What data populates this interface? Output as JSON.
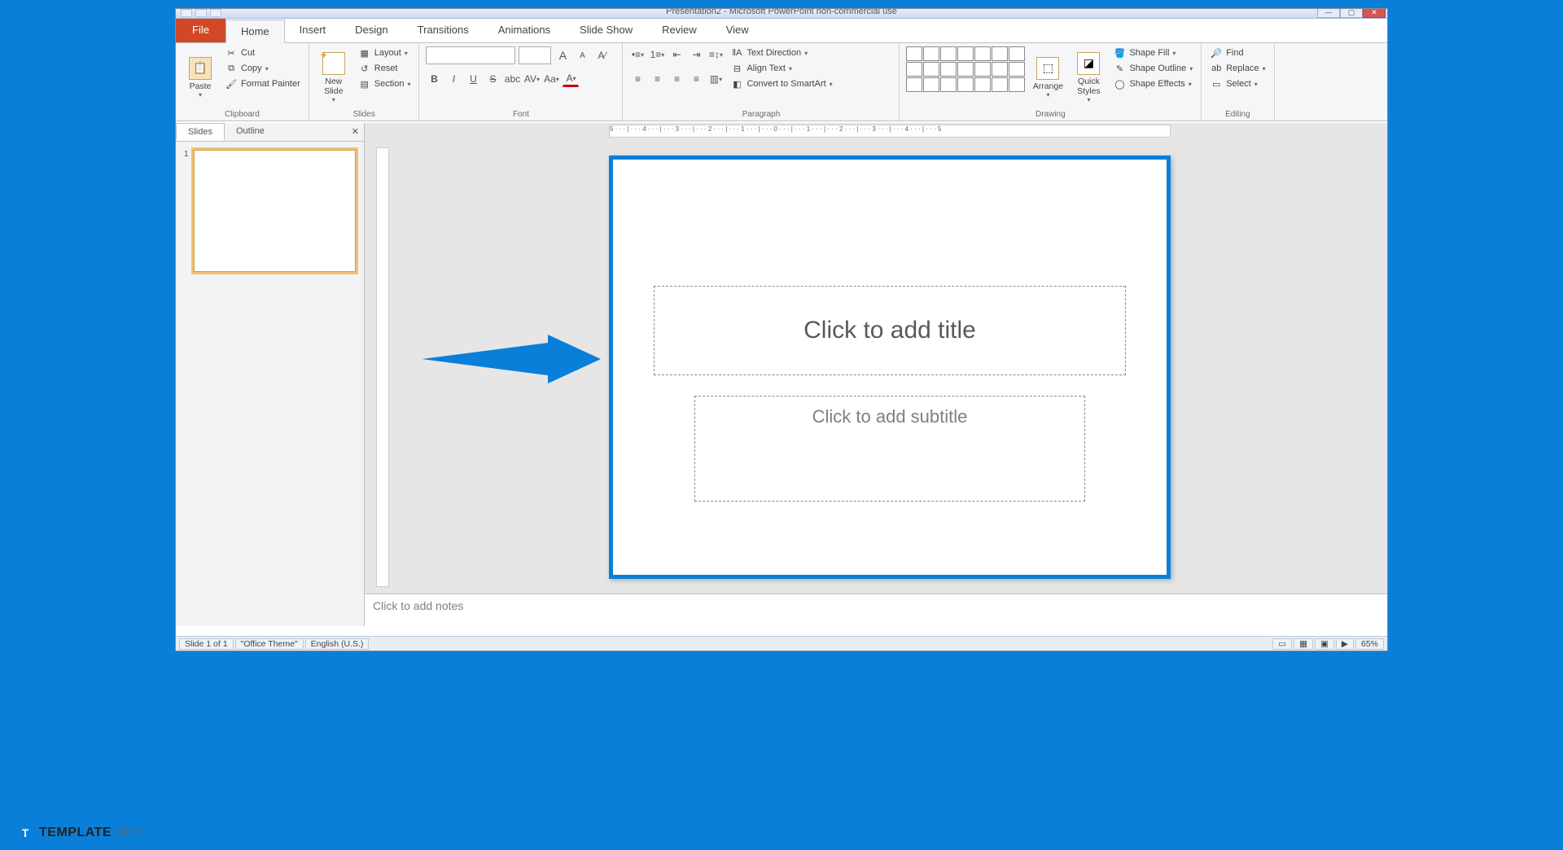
{
  "titlebar": {
    "title": "Presentation2 - Microsoft PowerPoint non-commercial use"
  },
  "tabs": {
    "file": "File",
    "items": [
      "Home",
      "Insert",
      "Design",
      "Transitions",
      "Animations",
      "Slide Show",
      "Review",
      "View"
    ],
    "active": "Home"
  },
  "ribbon": {
    "clipboard": {
      "label": "Clipboard",
      "paste": "Paste",
      "cut": "Cut",
      "copy": "Copy",
      "format_painter": "Format Painter"
    },
    "slides": {
      "label": "Slides",
      "new_slide": "New\nSlide",
      "layout": "Layout",
      "reset": "Reset",
      "section": "Section"
    },
    "font": {
      "label": "Font",
      "grow": "A",
      "shrink": "A"
    },
    "paragraph": {
      "label": "Paragraph",
      "text_direction": "Text Direction",
      "align_text": "Align Text",
      "convert_smartart": "Convert to SmartArt"
    },
    "drawing": {
      "label": "Drawing",
      "arrange": "Arrange",
      "quick_styles": "Quick\nStyles",
      "shape_fill": "Shape Fill",
      "shape_outline": "Shape Outline",
      "shape_effects": "Shape Effects"
    },
    "editing": {
      "label": "Editing",
      "find": "Find",
      "replace": "Replace",
      "select": "Select"
    }
  },
  "sidebar": {
    "tabs": {
      "slides": "Slides",
      "outline": "Outline"
    },
    "thumb_number": "1"
  },
  "slide": {
    "title_placeholder": "Click to add title",
    "subtitle_placeholder": "Click to add subtitle"
  },
  "notes": {
    "placeholder": "Click to add notes"
  },
  "status": {
    "slide_info": "Slide 1 of 1",
    "theme": "\"Office Theme\"",
    "language": "English (U.S.)",
    "zoom": "65%"
  },
  "branding": {
    "logo_letter": "T",
    "name_bold": "TEMPLATE",
    "name_rest": ".NET"
  }
}
